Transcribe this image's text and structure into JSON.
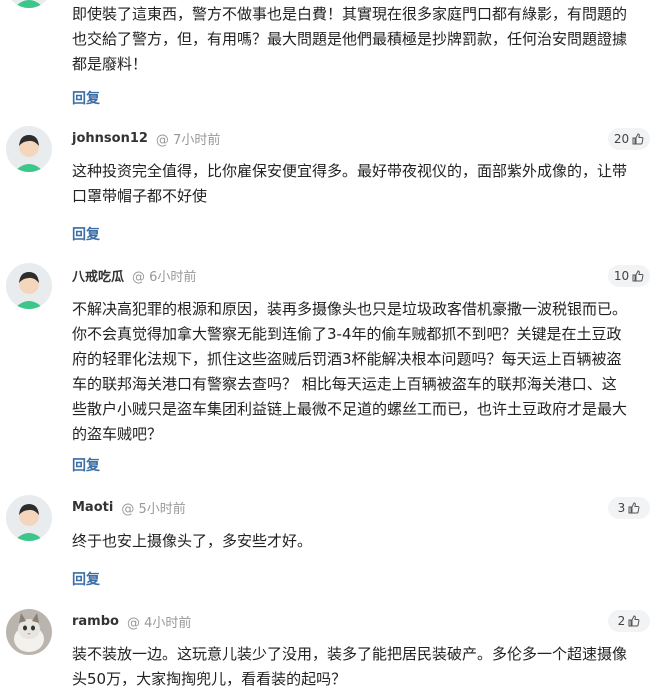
{
  "comments": [
    {
      "user": "",
      "time": "",
      "likes": "",
      "body_lines": [
        "即使裝了這東西，警方不做事也是白費！其實現在很多家庭門口都有綠影，有問題的",
        "也交給了警方，但，有用嗎？最大問題是他們最積極是抄牌罰款，任何治安問題證據",
        "都是廢料！"
      ],
      "reply": "回复"
    },
    {
      "user": "johnson12",
      "time": "@ 7小时前",
      "likes": "20",
      "body_lines": [
        "这种投资完全值得，比你雇保安便宜得多。最好带夜视仪的，面部紫外成像的，让带",
        "口罩带帽子都不好使"
      ],
      "reply": "回复"
    },
    {
      "user": "八戒吃瓜",
      "time": "@ 6小时前",
      "likes": "10",
      "body_lines": [
        "不解决高犯罪的根源和原因，装再多摄像头也只是垃圾政客借机豪撒一波税银而已。",
        "你不会真觉得加拿大警察无能到连偷了3-4年的偷车贼都抓不到吧？关键是在土豆政",
        "府的轻罪化法规下，抓住这些盗贼后罚酒3杯能解决根本问题吗？每天运上百辆被盗",
        "车的联邦海关港口有警察去查吗？ 相比每天运走上百辆被盗车的联邦海关港口、这",
        "些散户小贼只是盗车集团利益链上最微不足道的螺丝工而已，也许土豆政府才是最大",
        "的盗车贼吧？"
      ],
      "reply": "回复"
    },
    {
      "user": "Maoti",
      "time": "@ 5小时前",
      "likes": "3",
      "body_lines": [
        "终于也安上摄像头了，多安些才好。"
      ],
      "reply": "回复"
    },
    {
      "user": "rambo",
      "time": "@ 4小时前",
      "likes": "2",
      "body_lines": [
        "装不装放一边。这玩意儿装少了没用，装多了能把居民装破产。多伦多一个超速摄像",
        "头50万，大家掏掏兜儿，看看装的起吗？"
      ],
      "reply": ""
    }
  ],
  "colors": {
    "reply": "#3b6ea5",
    "avatar_face": "#f4d6bd",
    "avatar_hair": "#2d2d2d",
    "avatar_shirt": "#3cc68a"
  },
  "icons": {
    "like": "thumbs-up-icon",
    "avatar_default": "default-person-avatar-icon",
    "avatar_photo": "cat-photo-avatar-icon"
  }
}
